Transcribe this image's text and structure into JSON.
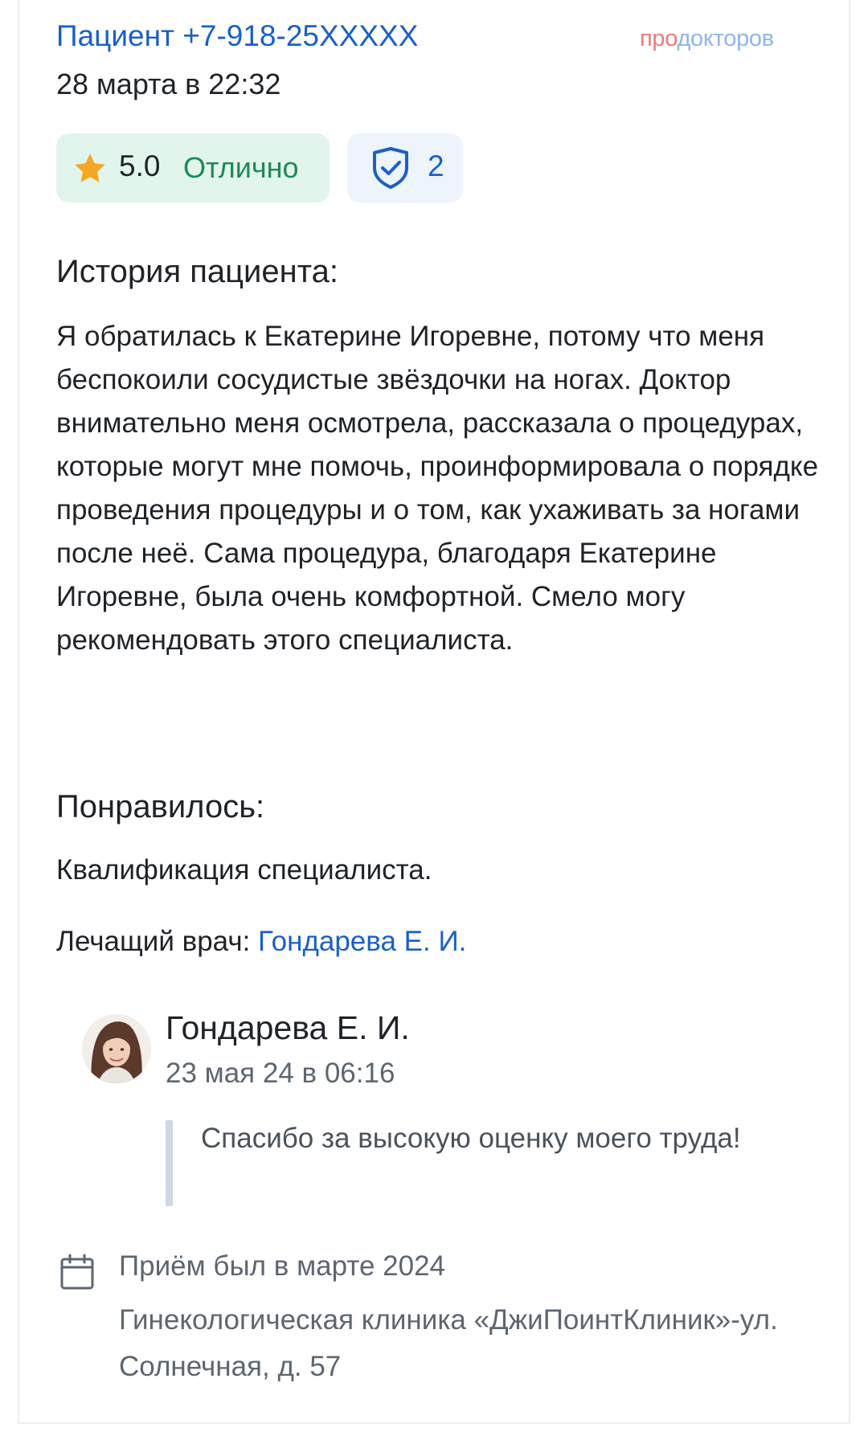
{
  "review": {
    "patient_name": "Пациент +7-918-25XXXXX",
    "date": "28 марта в 22:32",
    "brand_pro": "про",
    "brand_doc": "докторов",
    "rating_value": "5.0",
    "rating_label": "Отлично",
    "verify_count": "2"
  },
  "story": {
    "title": "История пациента:",
    "text": "Я обратилась к Екатерине Игоревне, потому что меня беспокоили сосудистые звёздочки на ногах. Доктор внимательно меня осмотрела, рассказала о процедурах, которые могут мне помочь, проинформировала о порядке проведения процедуры и о том, как ухаживать за ногами после неё. Сама процедура, благодаря Екатерине Игоревне, была очень комфортной. Смело могу рекомендовать этого специалиста."
  },
  "liked": {
    "title": "Понравилось:",
    "text": "Квалификация специалиста."
  },
  "doctor": {
    "label": "Лечащий врач:",
    "name": "Гондарева Е. И."
  },
  "reply": {
    "author": "Гондарева Е. И.",
    "date": "23 мая 24 в 06:16",
    "text": "Спасибо за высокую оценку моего труда!"
  },
  "visit": {
    "date_text": "Приём был в марте 2024",
    "clinic_text": "Гинекологическая клиника «ДжиПоинтКлиник»-ул. Солнечная, д. 57"
  },
  "colors": {
    "link": "#1a5fc8",
    "rating_bg": "#e1f5ec",
    "rating_text": "#1c8a57",
    "star": "#f5a623",
    "verify_bg": "#eef4fc",
    "muted_text": "#5d6670"
  },
  "icons": {
    "rating": "star-icon",
    "verify": "shield-check-icon",
    "visit": "calendar-icon"
  }
}
